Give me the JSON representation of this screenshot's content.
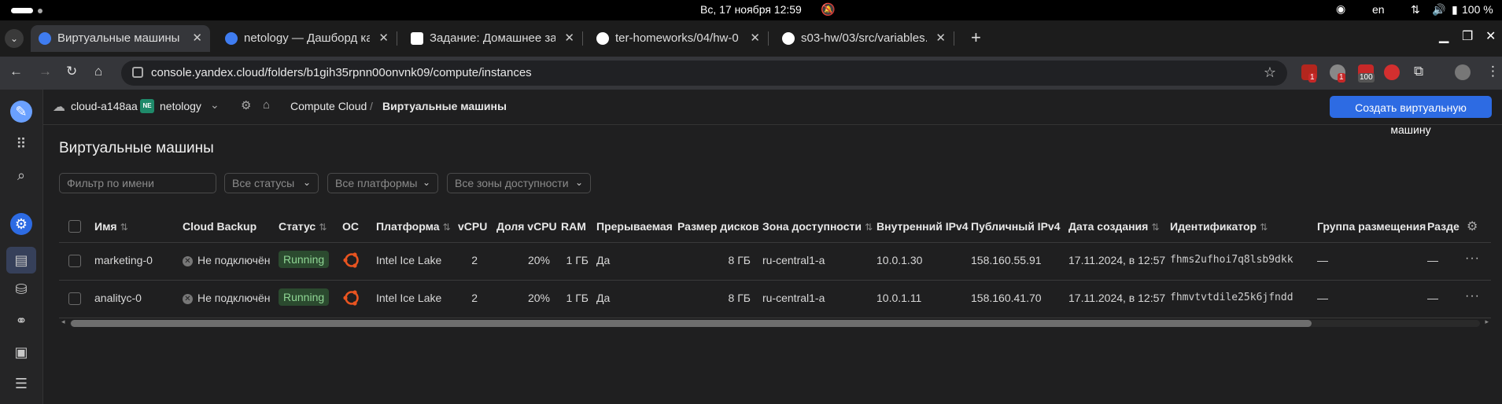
{
  "os": {
    "clock": "Вс, 17 ноября  12:59",
    "lang": "en",
    "battery": "100 %"
  },
  "tabs": [
    {
      "label": "Виртуальные машины |",
      "icon": "yandex-cloud-icon",
      "color": "#3f7cf0",
      "active": true
    },
    {
      "label": "netology — Дашборд ка",
      "icon": "yandex-cloud-icon",
      "color": "#3f7cf0",
      "active": false
    },
    {
      "label": "Задание: Домашнее зад",
      "icon": "netology-icon",
      "color": "#ffffff",
      "active": false
    },
    {
      "label": "ter-homeworks/04/hw-0",
      "icon": "github-icon",
      "color": "#ffffff",
      "active": false
    },
    {
      "label": "s03-hw/03/src/variables.",
      "icon": "github-icon",
      "color": "#ffffff",
      "active": false
    }
  ],
  "address": {
    "url": "console.yandex.cloud/folders/b1gih35rpnn00onvnk09/compute/instances"
  },
  "extensions": {
    "badge1": "1",
    "badge2": "1",
    "badge3": "100"
  },
  "header": {
    "cloud": "cloud-a148aa",
    "folder_badge": "NE",
    "folder": "netology",
    "crumb_service": "Compute Cloud",
    "crumb_sep": "/",
    "crumb_page": "Виртуальные машины",
    "create_button": "Создать виртуальную машину"
  },
  "page": {
    "title": "Виртуальные машины"
  },
  "filters": {
    "name_placeholder": "Фильтр по имени",
    "status": "Все статусы",
    "platform": "Все платформы",
    "zone": "Все зоны доступности"
  },
  "table": {
    "columns": {
      "name": "Имя",
      "backup": "Cloud Backup",
      "status": "Статус",
      "os": "ОС",
      "platform": "Платформа",
      "vcpu": "vCPU",
      "vcpu_share": "Доля vCPU",
      "ram": "RAM",
      "preemptible": "Прерываемая",
      "disk": "Размер дисков",
      "zone": "Зона доступности",
      "ip_int": "Внутренний IPv4",
      "ip_pub": "Публичный IPv4",
      "created": "Дата создания",
      "id": "Идентификатор",
      "group": "Группа размещения",
      "extra": "Разде"
    },
    "rows": [
      {
        "name": "marketing-0",
        "backup": "Не подключён",
        "status": "Running",
        "platform": "Intel Ice Lake",
        "vcpu": "2",
        "vcpu_share": "20%",
        "ram": "1 ГБ",
        "preemptible": "Да",
        "disk": "8 ГБ",
        "zone": "ru-central1-a",
        "ip_int": "10.0.1.30",
        "ip_pub": "158.160.55.91",
        "created": "17.11.2024, в 12:57",
        "id": "fhms2ufhoi7q8lsb9dkk",
        "group": "—",
        "extra": "—"
      },
      {
        "name": "analityc-0",
        "backup": "Не подключён",
        "status": "Running",
        "platform": "Intel Ice Lake",
        "vcpu": "2",
        "vcpu_share": "20%",
        "ram": "1 ГБ",
        "preemptible": "Да",
        "disk": "8 ГБ",
        "zone": "ru-central1-a",
        "ip_int": "10.0.1.11",
        "ip_pub": "158.160.41.70",
        "created": "17.11.2024, в 12:57",
        "id": "fhmvtvtdile25k6jfndd",
        "group": "—",
        "extra": "—"
      }
    ]
  }
}
